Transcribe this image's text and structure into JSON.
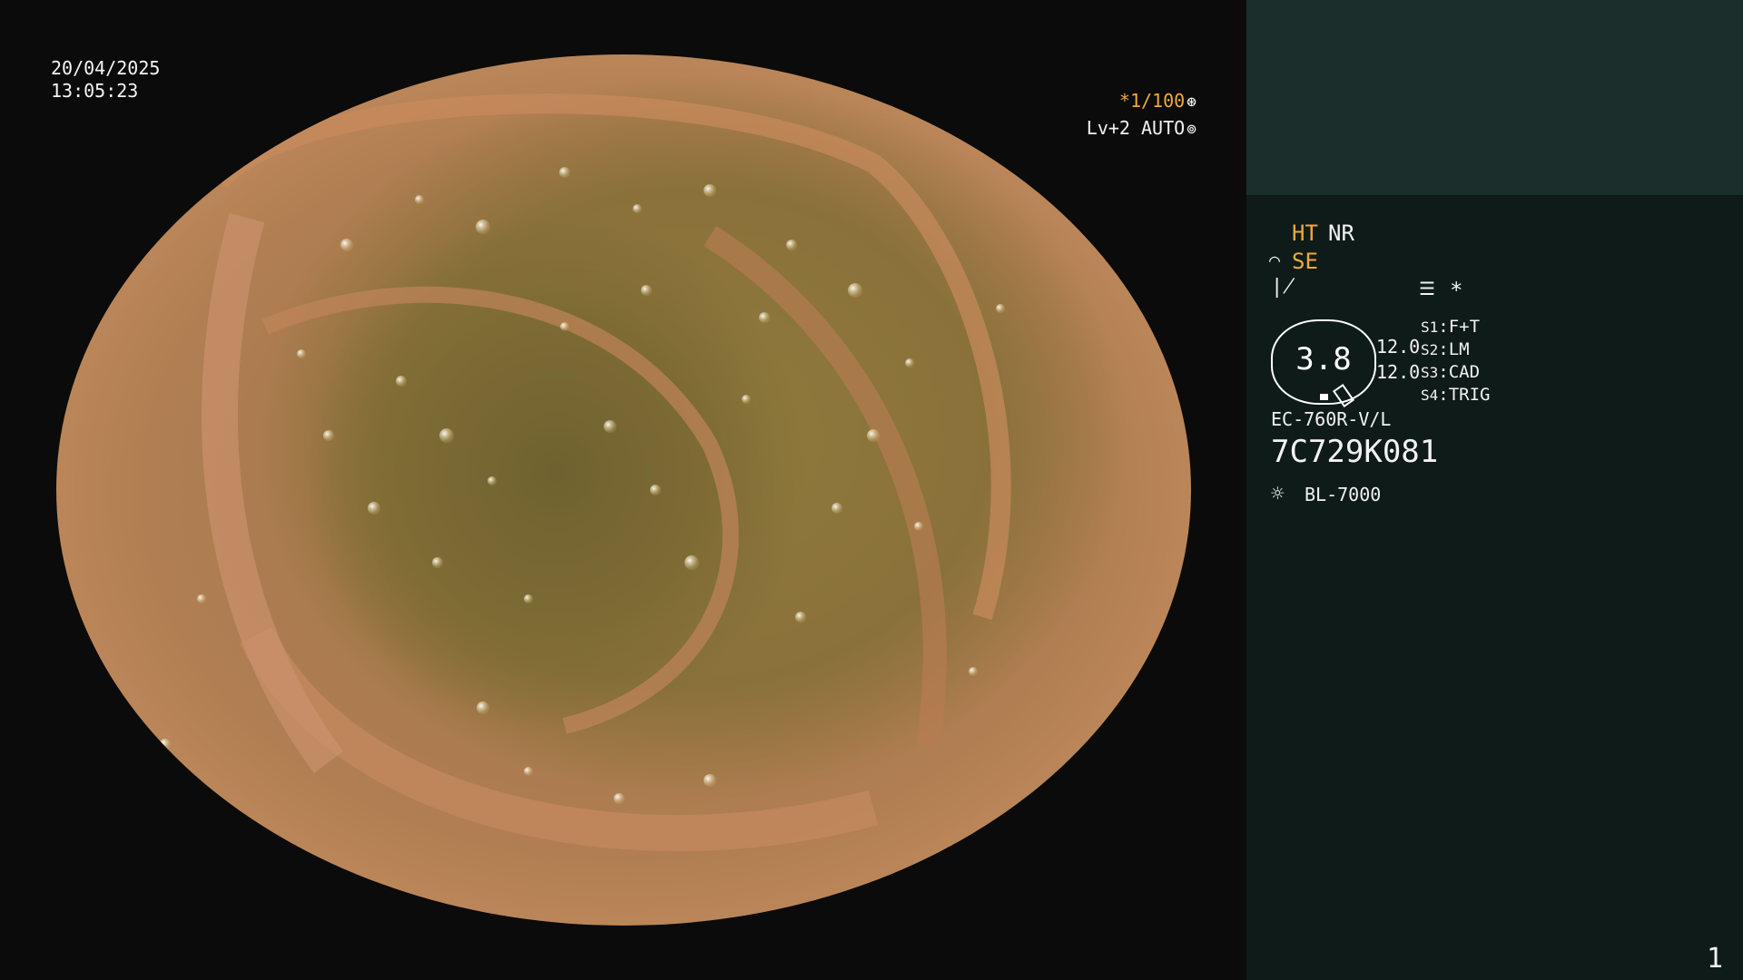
{
  "video": {
    "date": "20/04/2025",
    "time": "13:05:23",
    "exposure_value": "*1/100",
    "exposure_icon": "shutter-icon",
    "level_text": "Lv+2 AUTO",
    "auto_icon": "iris-icon"
  },
  "panel": {
    "ht": "HT",
    "nr": "NR",
    "se": "SE",
    "se_icon": "enhance-curve-icon",
    "freeze_icon": "freeze-icon",
    "menu_icon": "settings-list-icon",
    "asterisk": "*",
    "gauge_value": "3.8",
    "left_value_1": "12.0",
    "left_value_2": "12.0",
    "switches": [
      {
        "key": "S1",
        "value": "F+T"
      },
      {
        "key": "S2",
        "value": "LM"
      },
      {
        "key": "S3",
        "value": "CAD"
      },
      {
        "key": "S4",
        "value": "TRIG"
      }
    ],
    "scope_model": "EC-760R-V/L",
    "serial": "7C729K081",
    "light_icon": "light-source-icon",
    "light_source": "BL-7000",
    "page_number": "1"
  },
  "colors": {
    "accent_orange": "#f0a93a",
    "panel_bg": "#0f1b19",
    "panel_top_bg": "#1b2e2c"
  }
}
